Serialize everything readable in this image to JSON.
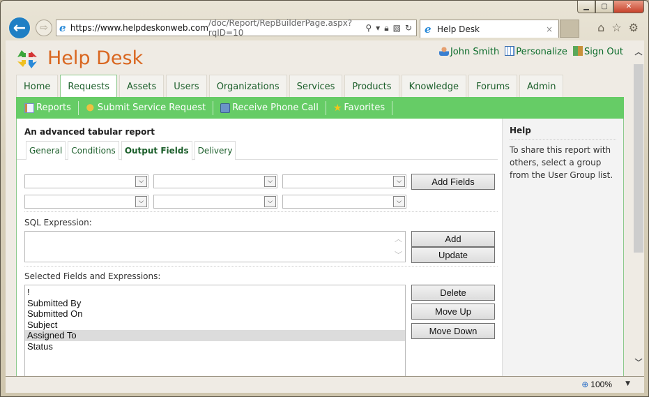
{
  "browser": {
    "url_host": "https://www.helpdeskonweb.com",
    "url_path": "/doc/Report/RepBuilderPage.aspx?rqID=10",
    "tab_title": "Help Desk",
    "tab_close": "×",
    "zoom_level": "100%"
  },
  "header": {
    "brand": "Help Desk",
    "user_name": "John Smith",
    "personalize": "Personalize",
    "sign_out": "Sign Out"
  },
  "nav": {
    "tabs": [
      {
        "label": "Home"
      },
      {
        "label": "Requests",
        "active": true
      },
      {
        "label": "Assets"
      },
      {
        "label": "Users"
      },
      {
        "label": "Organizations"
      },
      {
        "label": "Services"
      },
      {
        "label": "Products"
      },
      {
        "label": "Knowledge"
      },
      {
        "label": "Forums"
      },
      {
        "label": "Admin"
      }
    ]
  },
  "subnav": {
    "reports": "Reports",
    "submit_request": "Submit Service Request",
    "receive_call": "Receive Phone Call",
    "favorites": "Favorites"
  },
  "report": {
    "title": "An advanced tabular report",
    "tabs": [
      {
        "label": "General"
      },
      {
        "label": "Conditions"
      },
      {
        "label": "Output Fields",
        "active": true
      },
      {
        "label": "Delivery"
      }
    ],
    "field_selects": [
      "",
      "",
      "",
      "",
      "",
      ""
    ],
    "add_fields": "Add Fields",
    "sql_label": "SQL Expression:",
    "sql_value": "",
    "add": "Add",
    "update": "Update",
    "selected_label": "Selected Fields and Expressions:",
    "selected_fields": [
      "!",
      "Submitted By",
      "Submitted On",
      "Subject",
      "Assigned To",
      "Status"
    ],
    "selected_index": 4,
    "delete": "Delete",
    "move_up": "Move Up",
    "move_down": "Move Down"
  },
  "help": {
    "title": "Help",
    "text": "To share this report with others, select a group from the User Group list."
  }
}
